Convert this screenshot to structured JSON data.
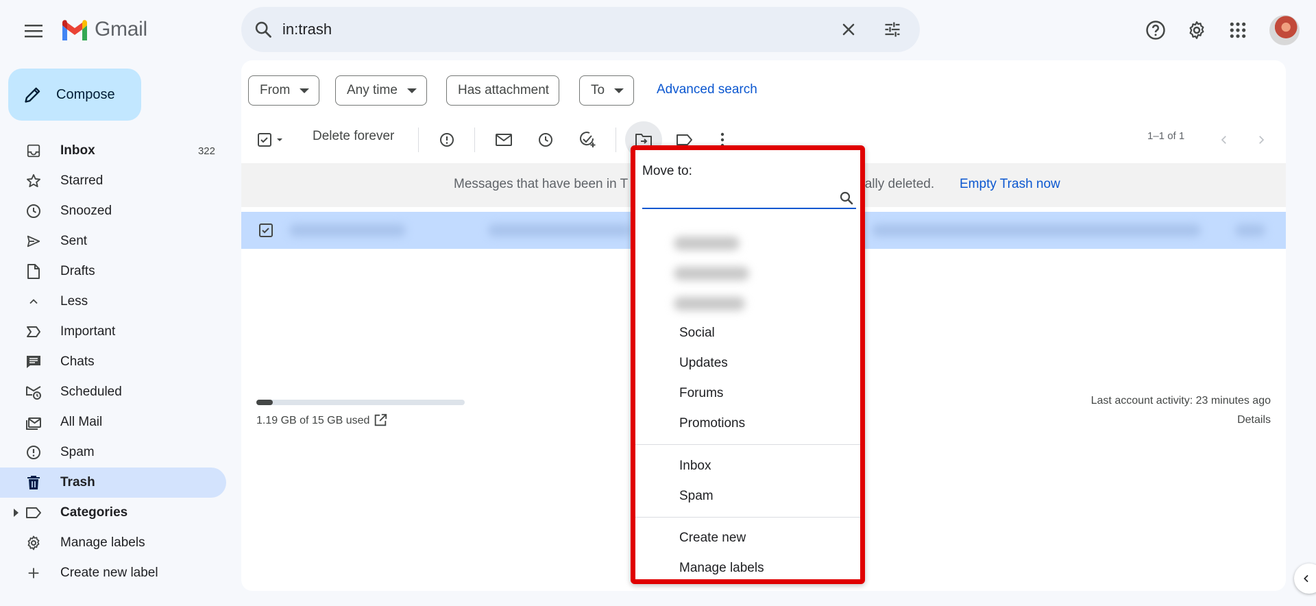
{
  "app": {
    "name": "Gmail"
  },
  "search": {
    "query": "in:trash"
  },
  "compose": {
    "label": "Compose"
  },
  "nav": {
    "items": [
      {
        "label": "Inbox",
        "count": "322",
        "icon": "inbox-icon",
        "bold": true
      },
      {
        "label": "Starred",
        "icon": "star-icon"
      },
      {
        "label": "Snoozed",
        "icon": "clock-icon"
      },
      {
        "label": "Sent",
        "icon": "send-icon"
      },
      {
        "label": "Drafts",
        "icon": "draft-icon"
      },
      {
        "label": "Less",
        "icon": "chevron-up-icon"
      },
      {
        "label": "Important",
        "icon": "important-icon"
      },
      {
        "label": "Chats",
        "icon": "chat-icon"
      },
      {
        "label": "Scheduled",
        "icon": "scheduled-icon"
      },
      {
        "label": "All Mail",
        "icon": "all-mail-icon"
      },
      {
        "label": "Spam",
        "icon": "spam-icon"
      },
      {
        "label": "Trash",
        "icon": "trash-icon",
        "bold": true,
        "active": true
      },
      {
        "label": "Categories",
        "icon": "label-icon",
        "bold": true
      },
      {
        "label": "Manage labels",
        "icon": "gear-icon"
      },
      {
        "label": "Create new label",
        "icon": "plus-icon"
      }
    ]
  },
  "filters": {
    "from": "From",
    "any_time": "Any time",
    "has_attachment": "Has attachment",
    "to": "To",
    "advanced": "Advanced search"
  },
  "toolbar": {
    "delete_forever": "Delete forever",
    "pager": "1–1 of 1"
  },
  "banner": {
    "text": "Messages that have been in T",
    "text_end": "ically deleted.",
    "empty_trash": "Empty Trash now"
  },
  "footer": {
    "storage": "1.19 GB of 15 GB used",
    "storage_used_fraction": 0.079,
    "activity": "Last account activity: 23 minutes ago",
    "details": "Details"
  },
  "move_menu": {
    "title": "Move to:",
    "categories": [
      "Social",
      "Updates",
      "Forums",
      "Promotions"
    ],
    "folders": [
      "Inbox",
      "Spam"
    ],
    "actions": [
      "Create new",
      "Manage labels"
    ]
  },
  "colors": {
    "accent": "#0b57d0",
    "highlight": "#e00000",
    "selected_row": "#c2dbff",
    "compose": "#c2e7ff"
  }
}
